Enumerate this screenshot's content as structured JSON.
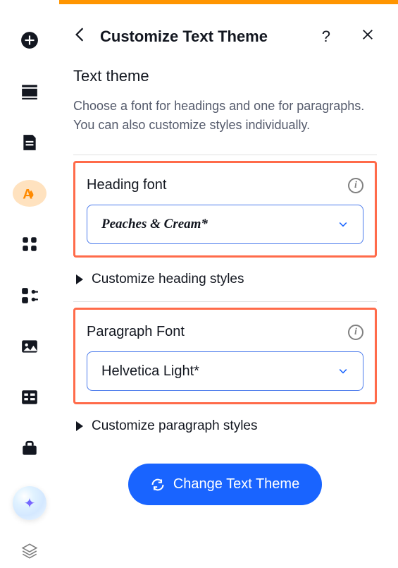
{
  "header": {
    "title": "Customize Text Theme"
  },
  "sidebar": {
    "icons": [
      "add",
      "section",
      "page",
      "theme",
      "apps",
      "integrations",
      "media",
      "table",
      "business"
    ]
  },
  "section": {
    "title": "Text theme",
    "description": "Choose a font for headings and one for paragraphs. You can also customize styles individually."
  },
  "heading_font": {
    "label": "Heading font",
    "value": "Peaches & Cream*",
    "expand_label": "Customize heading styles"
  },
  "paragraph_font": {
    "label": "Paragraph Font",
    "value": "Helvetica Light*",
    "expand_label": "Customize paragraph styles"
  },
  "cta": {
    "label": "Change Text Theme"
  }
}
